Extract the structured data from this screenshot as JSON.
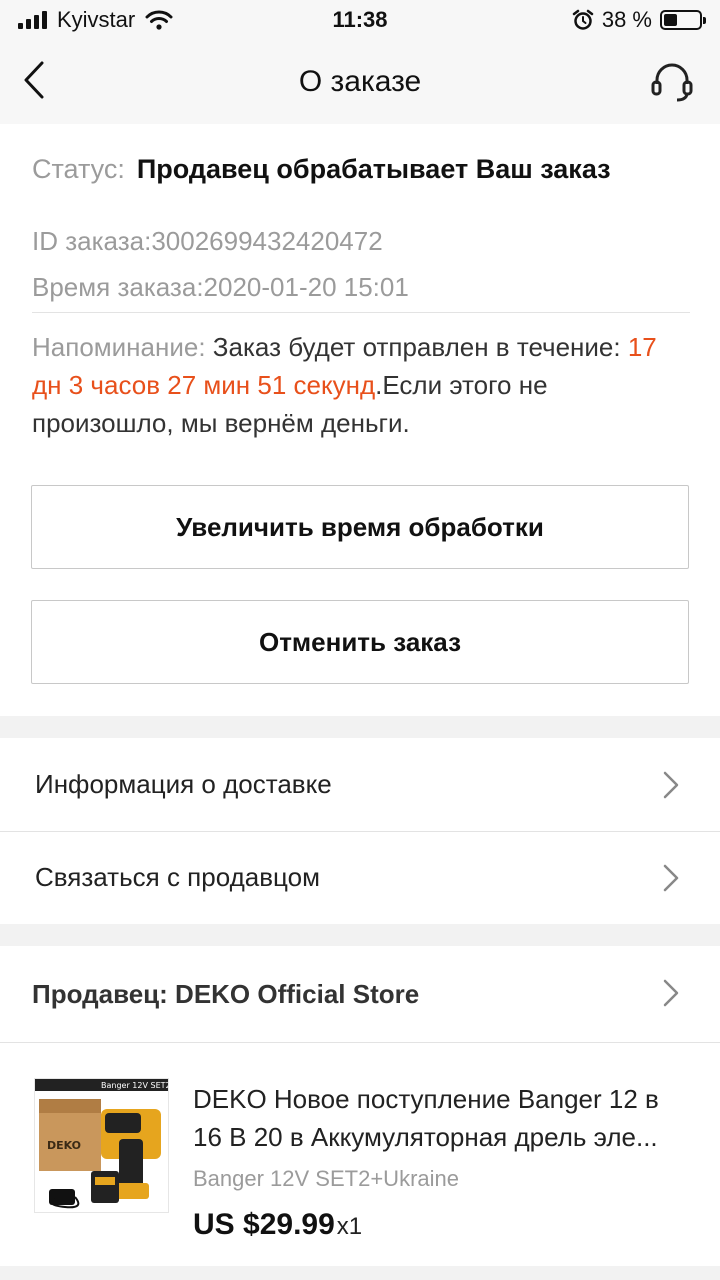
{
  "status_bar": {
    "carrier": "Kyivstar",
    "time": "11:38",
    "battery_text": "38 %",
    "battery_level": 0.38
  },
  "nav": {
    "title": "О заказе",
    "back_icon": "chevron-left-icon",
    "support_icon": "headset-icon"
  },
  "order": {
    "status_label": "Статус:",
    "status_value": "Продавец обрабатывает Ваш заказ",
    "id_line": "ID заказа:3002699432420472",
    "time_line": "Время заказа:2020-01-20 15:01",
    "reminder_label": "Напоминание:",
    "reminder_text": " Заказ будет отправлен в течение: ",
    "countdown": "17 дн 3 часов 27 мин 51 секунд",
    "reminder_tail": ".Если этого не произошло, мы вернём деньги."
  },
  "actions": {
    "extend_label": "Увеличить время обработки",
    "cancel_label": "Отменить заказ"
  },
  "links": {
    "delivery_info": "Информация о доставке",
    "contact_seller": "Связаться с продавцом"
  },
  "seller": {
    "label": "Продавец: DEKO Official Store"
  },
  "product": {
    "title": "DEKO Новое поступление Banger 12 в 16 В 20 в Аккумуляторная дрель эле...",
    "variant": "Banger 12V SET2+Ukraine",
    "price": "US $29.99",
    "quantity": "x1",
    "image_caption": "Banger 12V SET2",
    "image_brand": "DEKO"
  },
  "colors": {
    "accent": "#e8501b",
    "muted": "#9b9b9b",
    "background": "#f2f2f2"
  }
}
